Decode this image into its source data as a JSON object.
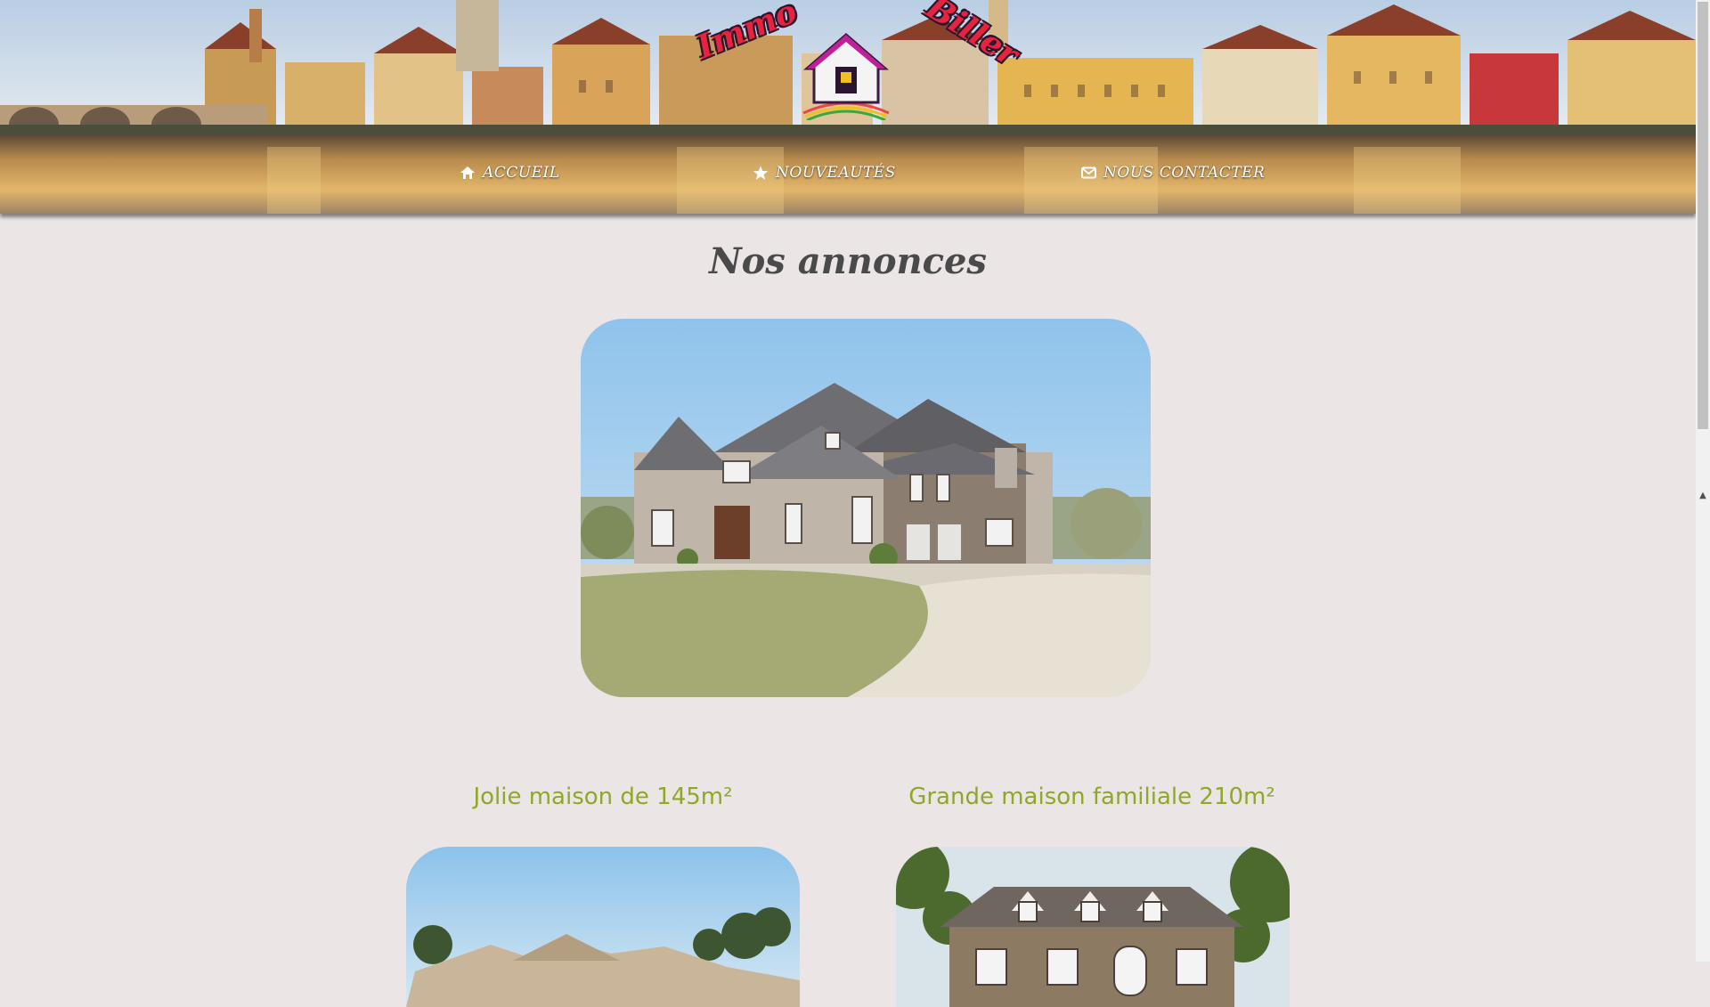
{
  "logo": {
    "word1": "Immo",
    "word2": "Biller"
  },
  "nav": [
    {
      "label": "ACCUEIL",
      "icon": "home-icon"
    },
    {
      "label": "NOUVEAUTÉS",
      "icon": "star-icon"
    },
    {
      "label": "NOUS CONTACTER",
      "icon": "envelope-icon"
    }
  ],
  "main": {
    "title": "Nos annonces",
    "listings": [
      {
        "title": "Jolie maison de 145m²"
      },
      {
        "title": "Grande maison familiale 210m²"
      }
    ]
  },
  "colors": {
    "accent_green": "#8fa826",
    "logo_red": "#e8233e",
    "background": "#ebe5e5"
  }
}
